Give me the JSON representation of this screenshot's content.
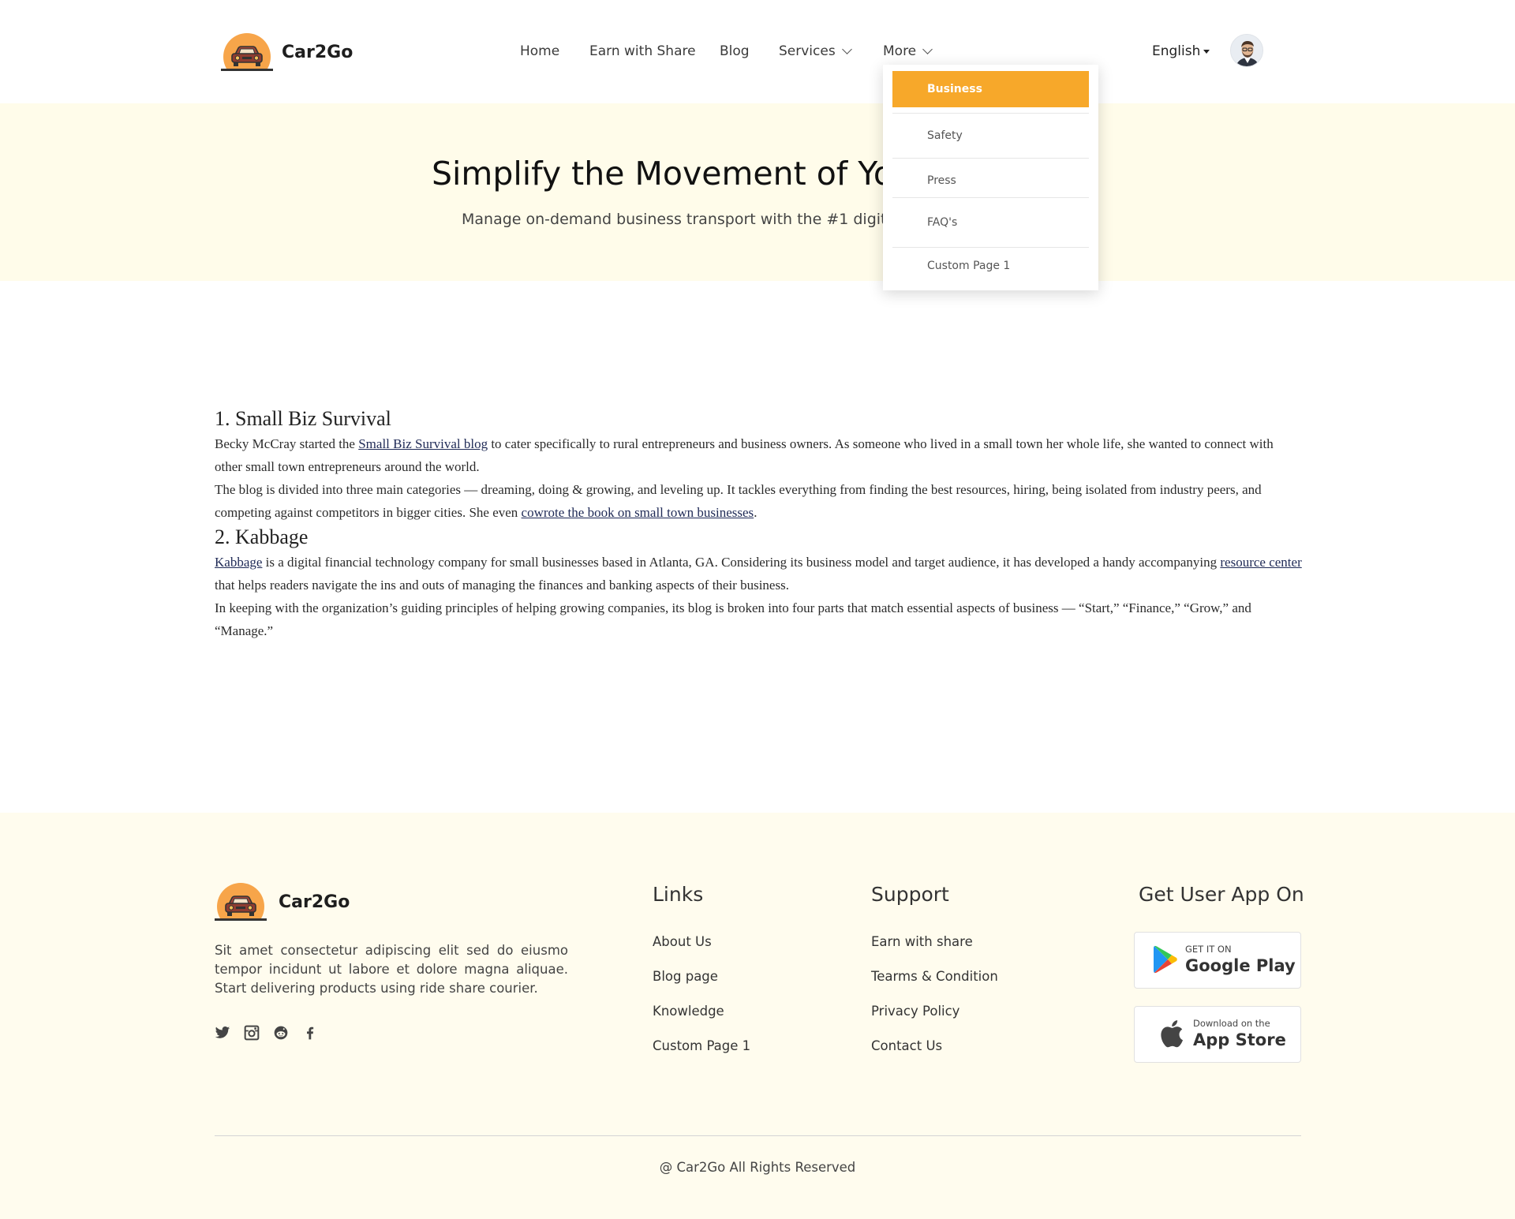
{
  "brand": {
    "name": "Car2Go"
  },
  "nav": {
    "items": [
      {
        "label": "Home"
      },
      {
        "label": "Earn with Share"
      },
      {
        "label": "Blog"
      },
      {
        "label": "Services"
      },
      {
        "label": "More"
      }
    ],
    "language": "English"
  },
  "dropdown": {
    "items": [
      {
        "label": "Business",
        "active": true
      },
      {
        "label": "Safety"
      },
      {
        "label": "Press"
      },
      {
        "label": "FAQ's"
      },
      {
        "label": "Custom Page 1"
      }
    ]
  },
  "hero": {
    "title": "Simplify the Movement of Yo",
    "subtitle": "Manage on-demand business transport with the #1 digital"
  },
  "article": {
    "s1": {
      "heading": "1. Small Biz Survival",
      "p1_a": "Becky McCray started the ",
      "p1_link": "Small Biz Survival blog",
      "p1_b": " to cater specifically to rural entrepreneurs and business owners. As someone who lived in a small town her whole life, she wanted to connect with other small town entrepreneurs around the world.",
      "p2_a": "The blog is divided into three main categories — dreaming, doing & growing, and leveling up. It tackles everything from finding the best resources, hiring, being isolated from industry peers, and competing against competitors in bigger cities. She even ",
      "p2_link": "cowrote the book on small town businesses",
      "p2_b": "."
    },
    "s2": {
      "heading": "2. Kabbage",
      "p1_link1": "Kabbage",
      "p1_a": " is a digital financial technology company for small businesses based in Atlanta, GA. Considering its business model and target audience, it has developed a handy accompanying ",
      "p1_link2": "resource center",
      "p1_b": " that helps readers navigate the ins and outs of managing the finances and banking aspects of their business.",
      "p2": "In keeping with the organization’s guiding principles of helping growing companies, its blog is broken into four parts that match essential aspects of business — “Start,” “Finance,” “Grow,” and “Manage.”"
    }
  },
  "footer": {
    "about": "Sit amet consectetur adipiscing elit sed do eiusmo tempor incidunt ut labore et dolore magna aliquae. Start delivering products using ride share courier.",
    "social": [
      "twitter-icon",
      "instagram-icon",
      "reddit-icon",
      "facebook-icon"
    ],
    "links": {
      "title": "Links",
      "items": [
        "About Us",
        "Blog page",
        "Knowledge",
        "Custom Page 1"
      ]
    },
    "support": {
      "title": "Support",
      "items": [
        "Earn with share",
        "Tearms & Condition",
        "Privacy Policy",
        "Contact Us"
      ]
    },
    "app": {
      "title": "Get User App On",
      "google_small": "GET IT ON",
      "google_big": "Google Play",
      "apple_small": "Download on the",
      "apple_big": "App Store"
    },
    "copyright": "@ Car2Go All Rights Reserved"
  },
  "colors": {
    "accent": "#f7a82a",
    "hero_bg": "#fffcea",
    "footer_bg": "#fffcee",
    "link": "#1f2a56"
  }
}
